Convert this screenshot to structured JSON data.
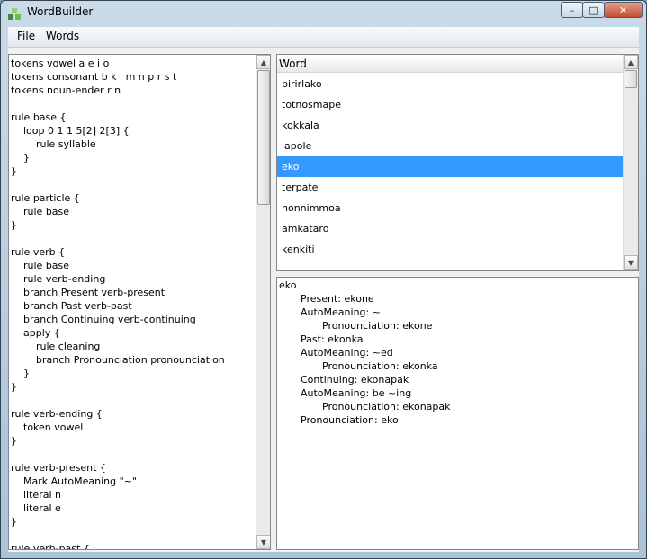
{
  "window": {
    "title": "WordBuilder",
    "controls": {
      "minimize": "–",
      "maximize": "□",
      "close": "✕"
    }
  },
  "menu": {
    "file": "File",
    "words": "Words"
  },
  "editor": {
    "text": "tokens vowel a e i o\ntokens consonant b k l m n p r s t\ntokens noun-ender r n\n\nrule base {\n\tloop 0 1 1 5[2] 2[3] {\n\t\trule syllable\n\t}\n}\n\nrule particle {\n\trule base\n}\n\nrule verb {\n\trule base\n\trule verb-ending\n\tbranch Present verb-present\n\tbranch Past verb-past\n\tbranch Continuing verb-continuing\n\tapply {\n\t\trule cleaning\n\t\tbranch Pronounciation pronounciation\n\t}\n}\n\nrule verb-ending {\n\ttoken vowel\n}\n\nrule verb-present {\n\tMark AutoMeaning \"~\"\n\tliteral n\n\tliteral e\n}\n\nrule verb-past {"
  },
  "words_list": {
    "header": "Word",
    "rows": [
      "birirlako",
      "totnosmape",
      "kokkala",
      "lapole",
      "eko",
      "terpate",
      "nonnimmoa",
      "amkataro",
      "kenkiti"
    ],
    "selected_index": 4
  },
  "detail": {
    "lines": [
      {
        "text": "eko",
        "indent": 0
      },
      {
        "text": "Present: ekone",
        "indent": 1
      },
      {
        "text": "AutoMeaning: ~",
        "indent": 1
      },
      {
        "text": "Pronounciation: ekone",
        "indent": 2
      },
      {
        "text": "Past: ekonka",
        "indent": 1
      },
      {
        "text": "AutoMeaning: ~ed",
        "indent": 1
      },
      {
        "text": "Pronounciation: ekonka",
        "indent": 2
      },
      {
        "text": "Continuing: ekonapak",
        "indent": 1
      },
      {
        "text": "AutoMeaning: be ~ing",
        "indent": 1
      },
      {
        "text": "Pronounciation: ekonapak",
        "indent": 2
      },
      {
        "text": "Pronounciation: eko",
        "indent": 1
      }
    ]
  },
  "colors": {
    "selection": "#3399ff",
    "title_bar": "#b9cfe1",
    "close_button": "#c44e34"
  },
  "icons": {
    "app": "wordbuilder-app-icon",
    "scroll_up": "arrow-up-icon",
    "scroll_down": "arrow-down-icon"
  }
}
